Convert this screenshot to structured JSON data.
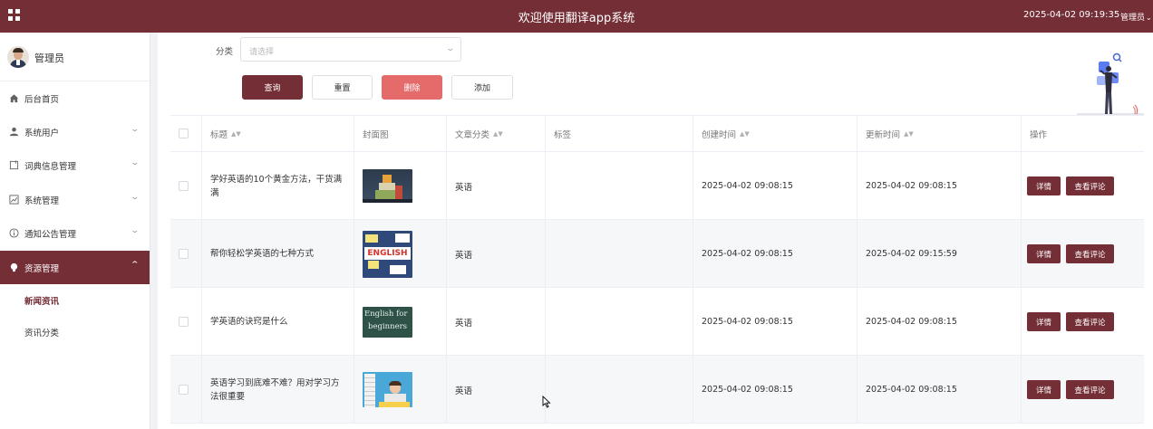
{
  "header": {
    "title": "欢迎使用翻译app系统",
    "datetime": "2025-04-02 09:19:35",
    "user_label": "管理员"
  },
  "sidebar": {
    "user_name": "管理员",
    "items": [
      {
        "label": "后台首页",
        "icon": "home-icon",
        "expandable": false
      },
      {
        "label": "系统用户",
        "icon": "user-icon",
        "expandable": true
      },
      {
        "label": "词典信息管理",
        "icon": "book-icon",
        "expandable": true
      },
      {
        "label": "系统管理",
        "icon": "chart-icon",
        "expandable": true
      },
      {
        "label": "通知公告管理",
        "icon": "info-icon",
        "expandable": true
      },
      {
        "label": "资源管理",
        "icon": "bulb-icon",
        "expandable": true,
        "active": true
      }
    ],
    "sub_items": [
      {
        "label": "新闻资讯",
        "active": true
      },
      {
        "label": "资讯分类",
        "active": false
      }
    ]
  },
  "filter": {
    "label": "分类",
    "placeholder": "请选择"
  },
  "toolbar": {
    "query": "查询",
    "reset": "重置",
    "delete": "删除",
    "add": "添加"
  },
  "table": {
    "columns": [
      "标题",
      "封面图",
      "文章分类",
      "标签",
      "创建时间",
      "更新时间",
      "操作"
    ],
    "rows": [
      {
        "title": "学好英语的10个黄金方法，干货满满",
        "thumb": "thumb-blocks-icon",
        "category": "英语",
        "tag": "",
        "created": "2025-04-02 09:08:15",
        "updated": "2025-04-02 09:08:15"
      },
      {
        "title": "帮你轻松学英语的七种方式",
        "thumb": "thumb-english-icon",
        "category": "英语",
        "tag": "",
        "created": "2025-04-02 09:08:15",
        "updated": "2025-04-02 09:15:59"
      },
      {
        "title": "学英语的诀窍是什么",
        "thumb": "thumb-chalkboard-icon",
        "category": "英语",
        "tag": "",
        "created": "2025-04-02 09:08:15",
        "updated": "2025-04-02 09:08:15"
      },
      {
        "title": "英语学习到底难不难？用对学习方法很重要",
        "thumb": "thumb-kid-books-icon",
        "category": "英语",
        "tag": "",
        "created": "2025-04-02 09:08:15",
        "updated": "2025-04-02 09:08:15"
      }
    ],
    "actions": {
      "detail": "详情",
      "comments": "查看评论"
    },
    "thumb_text": {
      "english": "ENGLISH",
      "chalk_1": "English for",
      "chalk_2": "beginners"
    }
  },
  "colors": {
    "brand": "#742e36",
    "danger": "#e56a6a"
  }
}
